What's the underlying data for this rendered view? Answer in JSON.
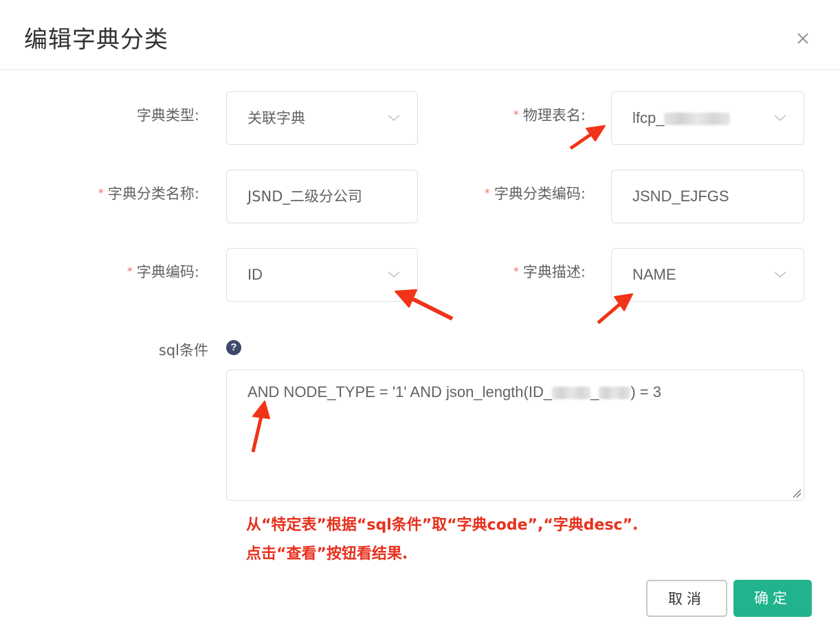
{
  "dialog": {
    "title": "编辑字典分类",
    "close_label": "×"
  },
  "form": {
    "required_mark": "*",
    "dict_type": {
      "label": "字典类型:",
      "value": "关联字典"
    },
    "table_name": {
      "label": "物理表名:",
      "value": "lfcp_"
    },
    "category_name": {
      "label": "字典分类名称:",
      "value": "JSND_二级分公司"
    },
    "category_code": {
      "label": "字典分类编码:",
      "value": "JSND_EJFGS"
    },
    "dict_code": {
      "label": "字典编码:",
      "value": "ID"
    },
    "dict_desc": {
      "label": "字典描述:",
      "value": "NAME"
    },
    "sql_condition": {
      "label": "sql条件",
      "help_icon": "?",
      "value_prefix": "AND NODE_TYPE = '1' AND json_length(ID_",
      "value_mid": "_",
      "value_suffix": ") = 3"
    }
  },
  "annotation": {
    "line1": "从“特定表”根据“sql条件”取“字典code”,“字典desc”.",
    "line2": "点击“查看”按钮看结果.",
    "color": "#e8301c"
  },
  "footer": {
    "cancel_label": "取消",
    "confirm_label": "确定"
  },
  "colors": {
    "primary": "#20b38e",
    "required": "#f56c6c",
    "border": "#dcdfe6"
  }
}
